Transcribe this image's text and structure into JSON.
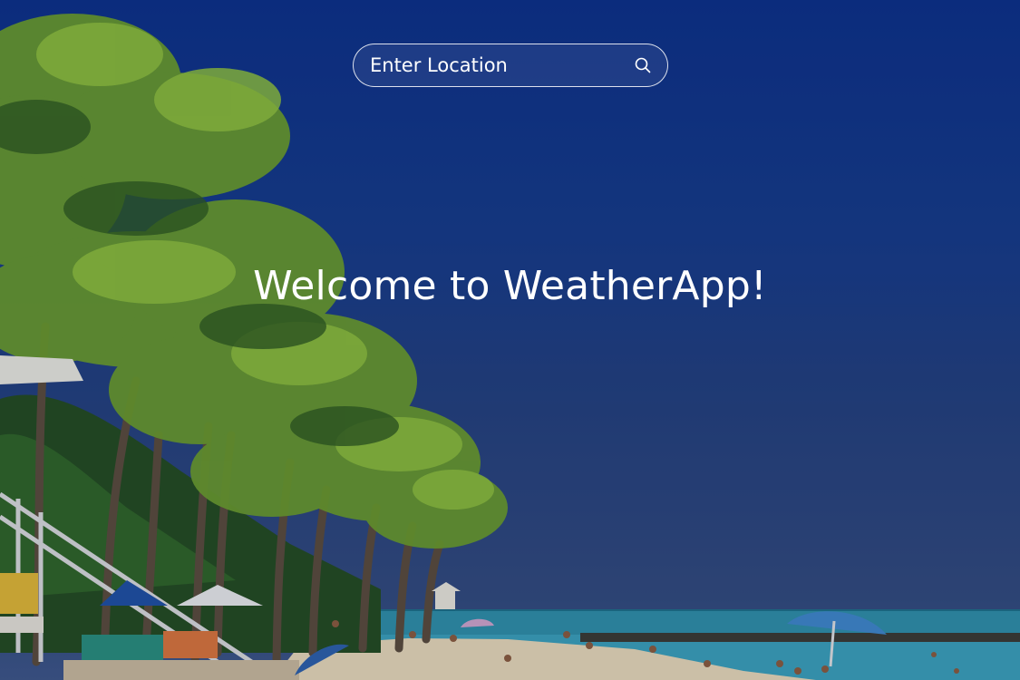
{
  "search": {
    "placeholder": "Enter Location",
    "icon": "search-icon"
  },
  "hero": {
    "title": "Welcome to WeatherApp!"
  },
  "colors": {
    "sky_top": "#0c2f86",
    "sky_bottom": "#3e5585",
    "text": "#ffffff",
    "sea": "#2f8fa8",
    "sand": "#e8d9b8",
    "palm": "#6f9e2c"
  }
}
